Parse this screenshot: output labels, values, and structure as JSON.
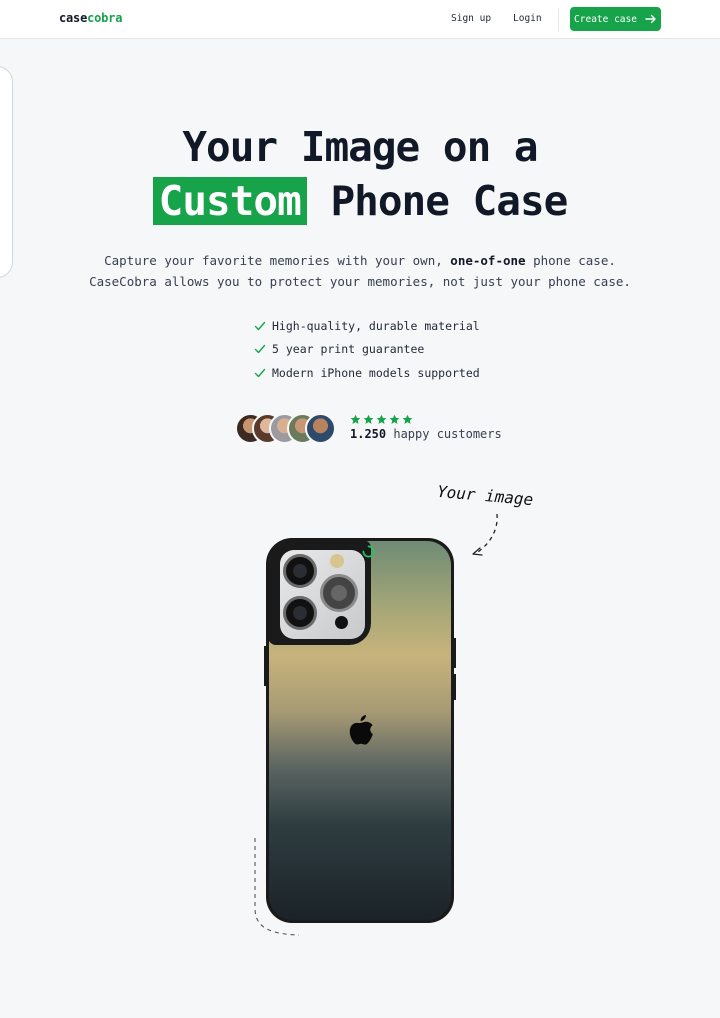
{
  "nav": {
    "logo_prefix": "case",
    "logo_suffix": "cobra",
    "signup": "Sign up",
    "login": "Login",
    "create_case": "Create case"
  },
  "hero": {
    "title_line1": "Your Image on a",
    "title_highlight": "Custom",
    "title_rest": "Phone Case",
    "sub_line1_pre": "Capture your favorite memories with your own, ",
    "sub_line1_bold": "one-of-one",
    "sub_line1_post": " phone case.",
    "sub_line2": "CaseCobra allows you to protect your memories, not just your phone case."
  },
  "features": [
    "High-quality, durable material",
    "5 year print guarantee",
    "Modern iPhone models supported"
  ],
  "social_proof": {
    "count": "1.250",
    "label": " happy customers",
    "rating_stars": 5
  },
  "annotation": {
    "your_image": "Your image"
  },
  "colors": {
    "accent": "#16a34a",
    "text": "#111827",
    "background": "#f6f7f8"
  }
}
